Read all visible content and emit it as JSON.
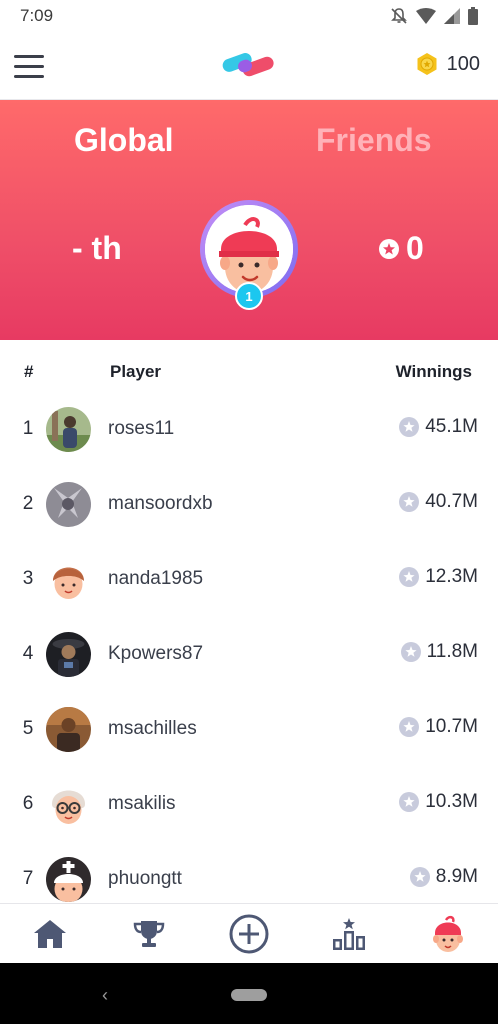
{
  "status_bar": {
    "time": "7:09",
    "icons": [
      "bell-off-icon",
      "wifi-icon",
      "signal-icon",
      "battery-icon"
    ]
  },
  "app_bar": {
    "menu_icon": "hamburger-menu-icon",
    "logo_icon": "app-logo",
    "coin_icon": "coin-icon",
    "coins": "100"
  },
  "hero": {
    "tabs": [
      {
        "label": "Global",
        "active": true
      },
      {
        "label": "Friends",
        "active": false
      }
    ],
    "rank": "- th",
    "score": "0",
    "level": "1"
  },
  "table": {
    "headers": {
      "rank": "#",
      "player": "Player",
      "winnings": "Winnings"
    },
    "rows": [
      {
        "rank": "1",
        "name": "roses11",
        "winnings": "45.1M",
        "avatar": "photo-avatar"
      },
      {
        "rank": "2",
        "name": "mansoordxb",
        "winnings": "40.7M",
        "avatar": "photo-avatar"
      },
      {
        "rank": "3",
        "name": "nanda1985",
        "winnings": "12.3M",
        "avatar": "cartoon-avatar"
      },
      {
        "rank": "4",
        "name": "Kpowers87",
        "winnings": "11.8M",
        "avatar": "photo-avatar"
      },
      {
        "rank": "5",
        "name": "msachilles",
        "winnings": "10.7M",
        "avatar": "photo-avatar"
      },
      {
        "rank": "6",
        "name": "msakilis",
        "winnings": "10.3M",
        "avatar": "cartoon-avatar"
      },
      {
        "rank": "7",
        "name": "phuongtt",
        "winnings": "8.9M",
        "avatar": "cartoon-avatar"
      }
    ]
  },
  "bottom_nav": [
    "home-icon",
    "trophy-icon",
    "add-circle-icon",
    "leaderboard-icon",
    "profile-avatar-icon"
  ],
  "colors": {
    "hero_top": "#ff6a6a",
    "hero_bottom": "#e73a62",
    "tab_inactive": "#ffb2b8",
    "badge": "#1cc7ef",
    "nav_icon": "#4e5874",
    "star_chip": "#c8cbdc"
  }
}
